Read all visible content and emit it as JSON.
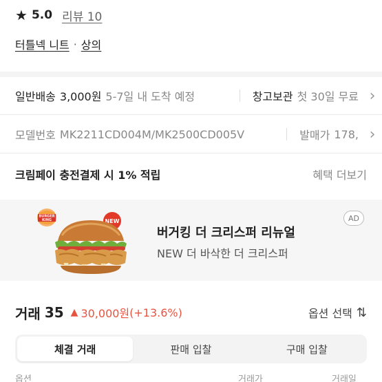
{
  "rating": {
    "value": "5.0",
    "review_link": "리뷰 10"
  },
  "category": {
    "item": "터틀넥 니트",
    "separator": "·",
    "parent": "상의"
  },
  "shipping": {
    "label": "일반배송",
    "price": "3,000원",
    "eta": "5-7일 내 도착 예정",
    "storage_label": "창고보관",
    "storage_detail": "첫 30일 무료"
  },
  "model": {
    "label": "모델번호",
    "number": "MK2211CD004M/MK2500CD005V",
    "release_label": "발매가",
    "release_value": "178,"
  },
  "points": {
    "text": "크림페이 충전결제 시 1% 적립",
    "more": "혜택 더보기"
  },
  "ad": {
    "badge": "AD",
    "title": "버거킹 더 크리스퍼 리뉴얼",
    "subtitle": "NEW 더 바삭한 더 크리스퍼",
    "brand_top": "BURGER",
    "brand_bottom": "KING",
    "new_badge": "NEW"
  },
  "trades": {
    "label": "거래",
    "count": "35",
    "price": "30,000원",
    "change": "(+13.6%)",
    "option_select": "옵션 선택"
  },
  "tabs": [
    {
      "label": "체결 거래",
      "active": true
    },
    {
      "label": "판매 입찰",
      "active": false
    },
    {
      "label": "구매 입찰",
      "active": false
    }
  ],
  "table_headers": [
    "옵션",
    "거래가",
    "거래일"
  ],
  "colors": {
    "accent_red": "#e8533f",
    "ad_background": "#f6f6f6",
    "text": "#222222"
  }
}
